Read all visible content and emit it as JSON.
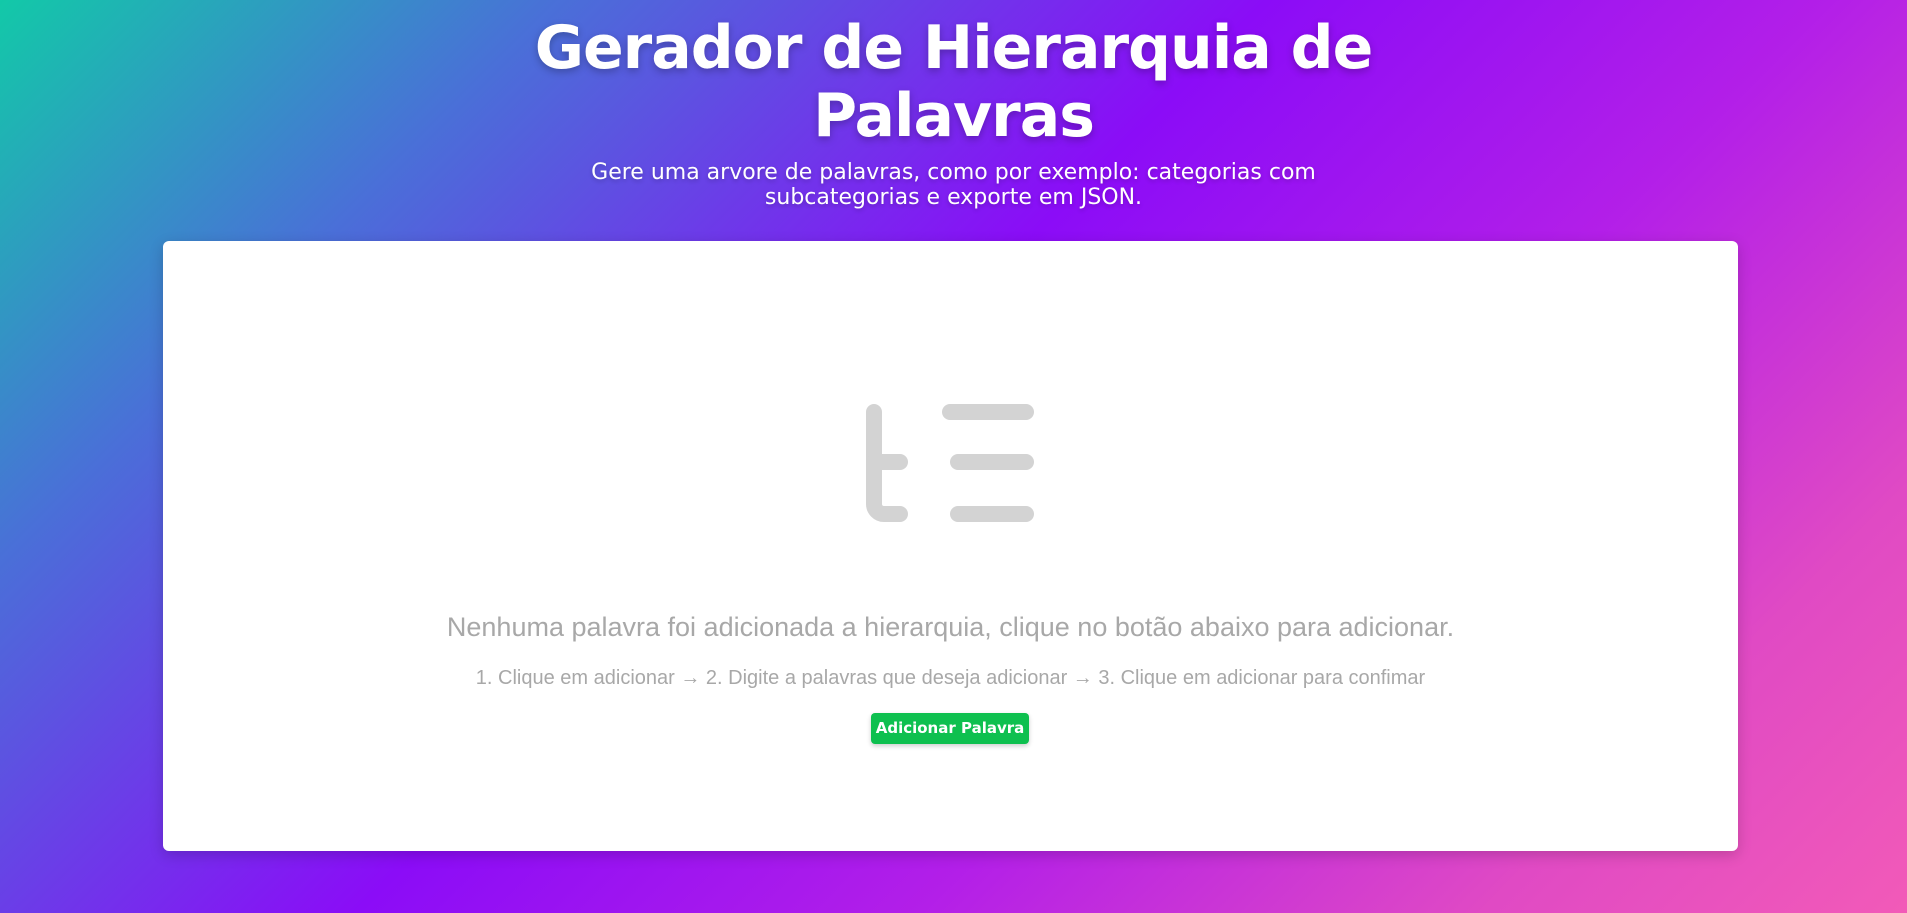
{
  "header": {
    "title": "Gerador de Hierarquia de Palavras",
    "subtitle": "Gere uma arvore de palavras, como por exemplo: categorias com subcategorias e exporte em JSON."
  },
  "empty_state": {
    "icon": "tree-list-icon",
    "icon_color": "#d3d3d3",
    "message": "Nenhuma palavra foi adicionada a hierarquia, clique no botão abaixo para adicionar.",
    "steps": "1. Clique em adicionar → 2. Digite a palavras que deseja adicionar → 3. Clique em adicionar para confimar",
    "button_label": "Adicionar Palavra",
    "button_color": "#0ec04f"
  },
  "colors": {
    "gradient_start": "#12c9a8",
    "gradient_mid": "#8b0cf7",
    "gradient_end": "#f25ab8"
  }
}
